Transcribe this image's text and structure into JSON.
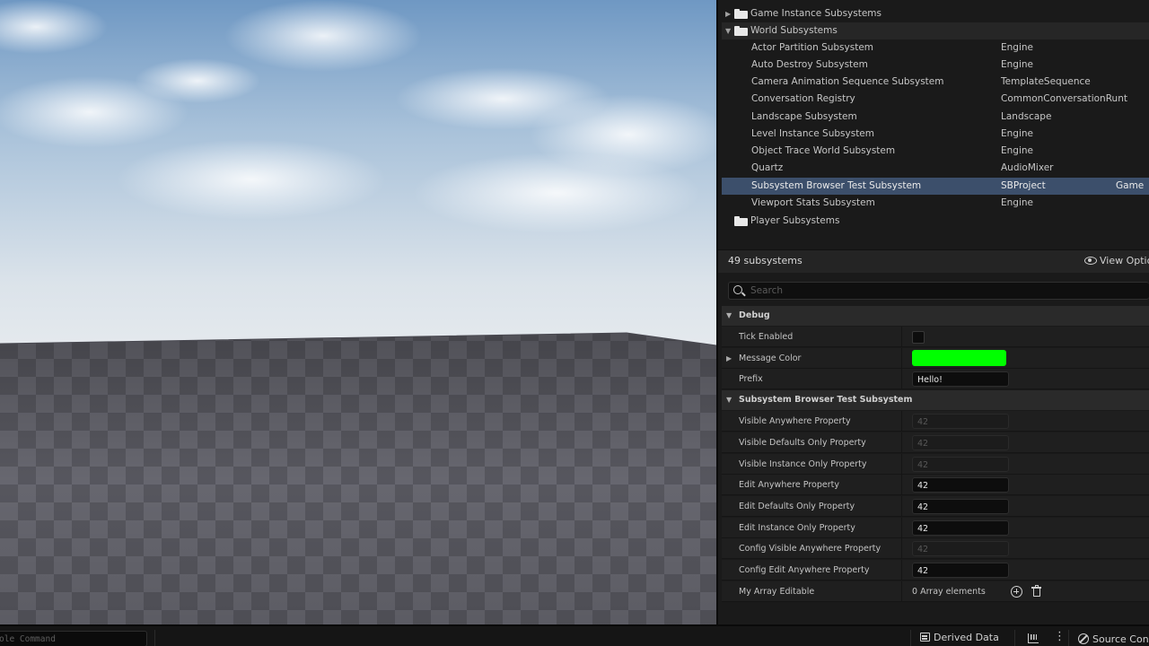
{
  "subsystem_tree": {
    "groups": [
      {
        "label": "Game Instance Subsystems",
        "expanded": false
      },
      {
        "label": "World Subsystems",
        "expanded": true
      },
      {
        "label": "Player Subsystems",
        "expanded": false
      }
    ],
    "rows": [
      {
        "name": "Actor Partition Subsystem",
        "module": "Engine",
        "category": ""
      },
      {
        "name": "Auto Destroy Subsystem",
        "module": "Engine",
        "category": ""
      },
      {
        "name": "Camera Animation Sequence Subsystem",
        "module": "TemplateSequence",
        "category": ""
      },
      {
        "name": "Conversation Registry",
        "module": "CommonConversationRunt",
        "category": ""
      },
      {
        "name": "Landscape Subsystem",
        "module": "Landscape",
        "category": ""
      },
      {
        "name": "Level Instance Subsystem",
        "module": "Engine",
        "category": ""
      },
      {
        "name": "Object Trace World Subsystem",
        "module": "Engine",
        "category": ""
      },
      {
        "name": "Quartz",
        "module": "AudioMixer",
        "category": ""
      },
      {
        "name": "Subsystem Browser Test Subsystem",
        "module": "SBProject",
        "category": "Game",
        "selected": true
      },
      {
        "name": "Viewport Stats Subsystem",
        "module": "Engine",
        "category": ""
      }
    ]
  },
  "count_bar": {
    "count_text": "49 subsystems",
    "view_options_label": "View Optio"
  },
  "search": {
    "placeholder": "Search"
  },
  "details": {
    "categories": [
      {
        "label": "Debug"
      },
      {
        "label": "Subsystem Browser Test Subsystem"
      }
    ],
    "debug": {
      "tick_enabled": {
        "label": "Tick Enabled",
        "checked": false
      },
      "message_color": {
        "label": "Message Color",
        "color": "#00ff00"
      },
      "prefix": {
        "label": "Prefix",
        "value": "Hello!"
      }
    },
    "properties": [
      {
        "label": "Visible Anywhere Property",
        "value": "42",
        "editable": false
      },
      {
        "label": "Visible Defaults Only Property",
        "value": "42",
        "editable": false
      },
      {
        "label": "Visible Instance Only Property",
        "value": "42",
        "editable": false
      },
      {
        "label": "Edit Anywhere Property",
        "value": "42",
        "editable": true
      },
      {
        "label": "Edit Defaults Only Property",
        "value": "42",
        "editable": true
      },
      {
        "label": "Edit Instance Only Property",
        "value": "42",
        "editable": true
      },
      {
        "label": "Config Visible Anywhere Property",
        "value": "42",
        "editable": false
      },
      {
        "label": "Config Edit Anywhere Property",
        "value": "42",
        "editable": true
      }
    ],
    "array": {
      "label": "My Array Editable",
      "value": "0 Array elements"
    }
  },
  "status_bar": {
    "console_placeholder": "ole Command",
    "derived_data_label": "Derived Data",
    "source_control_label": "Source Con"
  },
  "colors": {
    "selection": "#3c4f6b",
    "message_color": "#00ff00",
    "sky_top": "#7aa0c8",
    "floor_light": "#6f6f78",
    "floor_dark": "#55555d"
  }
}
